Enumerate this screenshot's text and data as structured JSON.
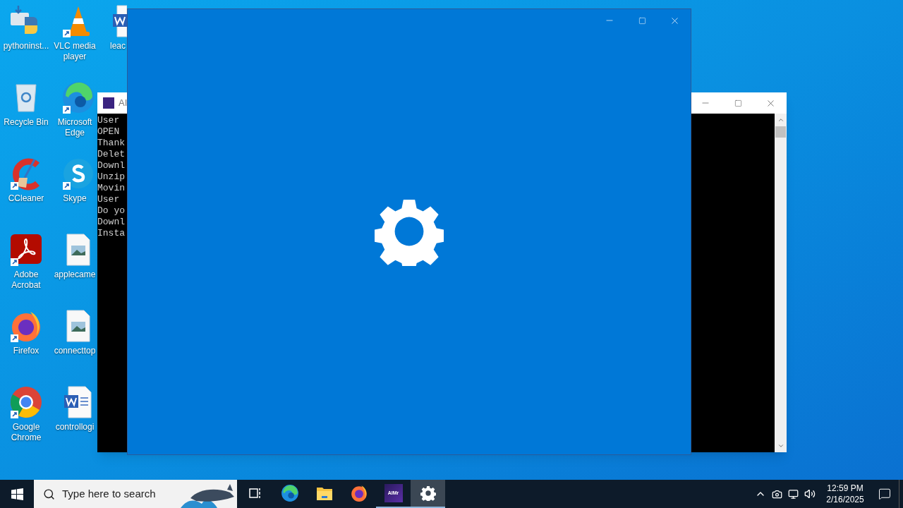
{
  "desktop_icons": [
    {
      "label": "pythoninst...",
      "kind": "python"
    },
    {
      "label": "Recycle Bin",
      "kind": "recycle-bin"
    },
    {
      "label": "CCleaner",
      "kind": "ccleaner"
    },
    {
      "label": "Adobe Acrobat",
      "kind": "acrobat"
    },
    {
      "label": "Firefox",
      "kind": "firefox"
    },
    {
      "label": "Google Chrome",
      "kind": "chrome"
    },
    {
      "label": "VLC media player",
      "kind": "vlc"
    },
    {
      "label": "Microsoft Edge",
      "kind": "edge"
    },
    {
      "label": "Skype",
      "kind": "skype"
    },
    {
      "label": "applecame",
      "kind": "image-file"
    },
    {
      "label": "connecttop",
      "kind": "image-file"
    },
    {
      "label": "controllogi",
      "kind": "word-file"
    },
    {
      "label": "leac",
      "kind": "word-file"
    }
  ],
  "console_window": {
    "title": "AI",
    "lines": [
      "User",
      "OPEN",
      "Thank",
      "Delet",
      "Downl",
      "Unzip",
      "Movin",
      "User",
      "Do yo",
      "Downl",
      "Insta"
    ]
  },
  "taskbar": {
    "search_placeholder": "Type here to search",
    "apps": [
      {
        "kind": "task-view",
        "selected": false,
        "running": false
      },
      {
        "kind": "edge",
        "selected": false,
        "running": false
      },
      {
        "kind": "explorer",
        "selected": false,
        "running": false
      },
      {
        "kind": "firefox",
        "selected": false,
        "running": false
      },
      {
        "kind": "aimr",
        "label": "AIMr",
        "selected": false,
        "running": true
      },
      {
        "kind": "settings",
        "selected": true,
        "running": true
      }
    ],
    "clock": {
      "time": "12:59 PM",
      "date": "2/16/2025"
    }
  }
}
